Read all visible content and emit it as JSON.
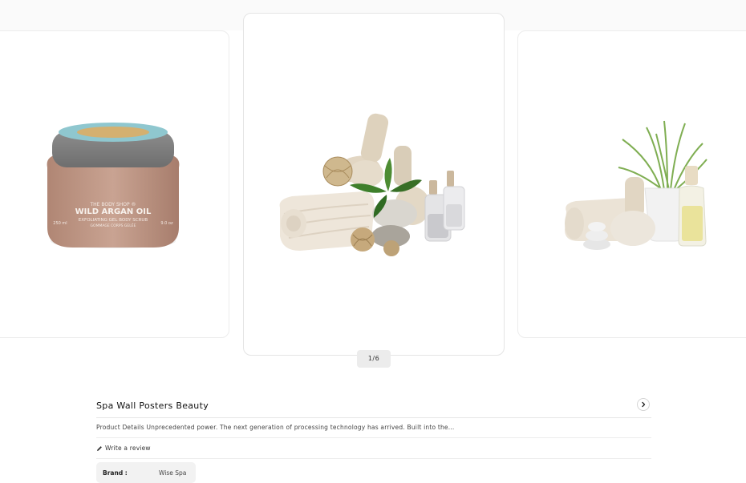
{
  "gallery": {
    "pager": "1/6",
    "left_image": {
      "jar_brand": "THE BODY SHOP ®",
      "jar_name": "WILD ARGAN OIL",
      "jar_line1": "EXFOLIATING GEL BODY SCRUB",
      "jar_line2": "GOMMAGE CORPS GELÉE",
      "jar_left": "250 ml",
      "jar_right": "9.0 oz"
    }
  },
  "product": {
    "title": "Spa Wall Posters Beauty",
    "description": "Product Details Unprecedented power. The next generation of processing technology has arrived. Built into the...",
    "write_review": "Write a review",
    "brand_label": "Brand :",
    "brand_value": "Wise Spa"
  },
  "icons": {
    "next": "chevron-right-icon",
    "review": "pencil-icon"
  }
}
